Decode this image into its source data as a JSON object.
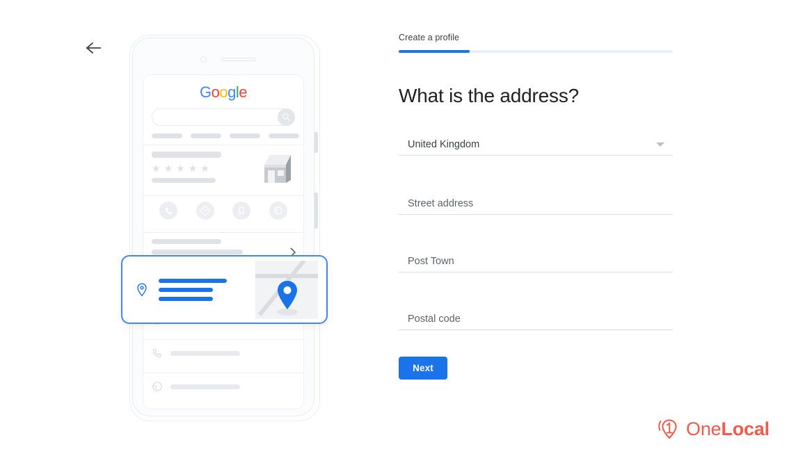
{
  "nav": {
    "back_icon": "arrow-left-icon",
    "back_label": "Back"
  },
  "form": {
    "step_label": "Create a profile",
    "progress_percent": 26,
    "progress_color": "#1a73e8",
    "progress_track_color": "#e8f0fe",
    "heading": "What is the address?",
    "fields": [
      {
        "name": "country",
        "label": "United Kingdom",
        "type": "select",
        "filled": true,
        "icon": "chevron-down-icon"
      },
      {
        "name": "street",
        "label": "Street address",
        "type": "text",
        "filled": false,
        "value": ""
      },
      {
        "name": "town",
        "label": "Post Town",
        "type": "text",
        "filled": false,
        "value": ""
      },
      {
        "name": "postal",
        "label": "Postal code",
        "type": "text",
        "filled": false,
        "value": ""
      }
    ],
    "submit_label": "Next",
    "submit_color": "#1a73e8"
  },
  "phone_preview": {
    "google_logo": {
      "letters": [
        "G",
        "o",
        "o",
        "g",
        "l",
        "e"
      ],
      "colors": [
        "#4285f4",
        "#ea4335",
        "#fbbc05",
        "#4285f4",
        "#34a853",
        "#ea4335"
      ]
    },
    "search_icon": "search-icon",
    "rating_stars": 5,
    "action_icons": [
      "phone-icon",
      "directions-icon",
      "bookmark-icon",
      "website-icon"
    ],
    "detail_rows": [
      {
        "icon": "clock-icon"
      },
      {
        "icon": "phone-icon"
      },
      {
        "icon": "globe-icon"
      }
    ],
    "address_card": {
      "pin_icon": "location-pin-outline-icon",
      "map_pin_icon": "location-pin-filled-icon",
      "highlight_color": "#4285f4",
      "line_color": "#1a73e8",
      "lines": 3
    },
    "chevron_icon": "chevron-right-icon",
    "storefront_icon": "storefront-icon"
  },
  "branding": {
    "logo_mark": "onelocal-pin-icon",
    "name_light": "One",
    "name_bold": "Local",
    "color": "#ef5b4c"
  }
}
